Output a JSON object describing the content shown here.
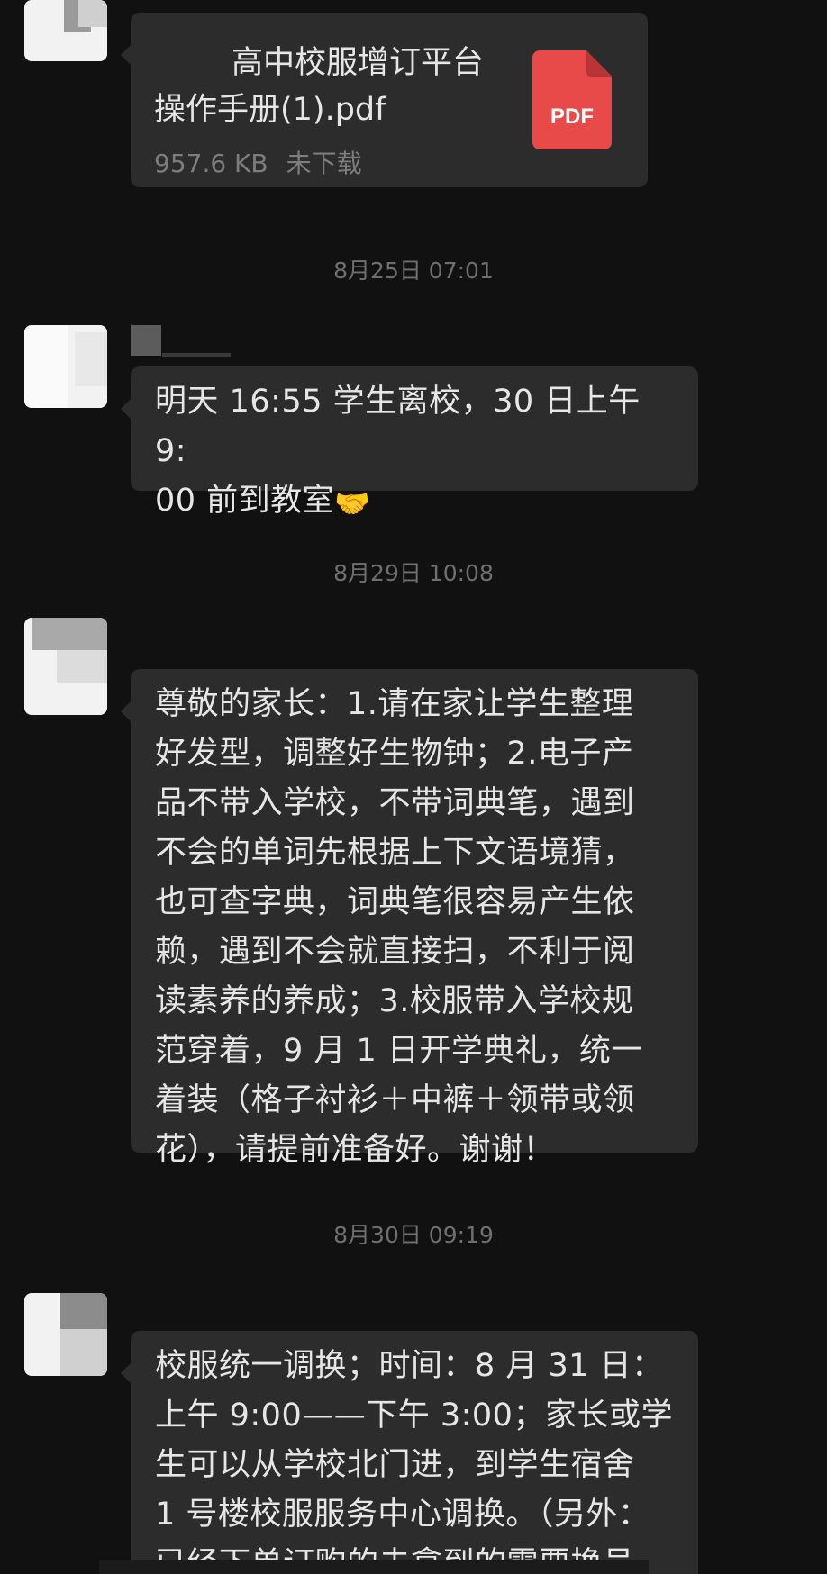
{
  "file_message": {
    "name_line1": "高中校服增订平台",
    "name_line2": "操作手册(1).pdf",
    "size": "957.6 KB",
    "status": "未下载",
    "icon_label": "PDF"
  },
  "timestamps": {
    "t1": "8月25日 07:01",
    "t2": "8月29日 10:08",
    "t3": "8月30日 09:19"
  },
  "messages": {
    "m1": "明天 16:55 学生离校，30 日上午 9:\n00 前到教室",
    "m1_emoji": "🤝",
    "m2": "尊敬的家长：1.请在家让学生整理\n好发型，调整好生物钟；2.电子产\n品不带入学校，不带词典笔，遇到\n不会的单词先根据上下文语境猜，\n也可查字典，词典笔很容易产生依\n赖，遇到不会就直接扫，不利于阅\n读素养的养成；3.校服带入学校规\n范穿着，9 月 1 日开学典礼，统一\n着装（格子衬衫＋中裤＋领带或领\n花），请提前准备好。谢谢！",
    "m3": "校服统一调换；时间：8 月 31 日：\n上午 9:00——下午 3:00；家长或学\n生可以从学校北门进，到学生宿舍\n1 号楼校服服务中心调换。（另外：\n已经下单订购的未拿到的需要换号"
  },
  "colors": {
    "background": "#111111",
    "bubble": "#2c2c2c",
    "text": "#e6e6e6",
    "timestamp": "#6f6f6f",
    "pdf_red": "#e84a4a"
  }
}
